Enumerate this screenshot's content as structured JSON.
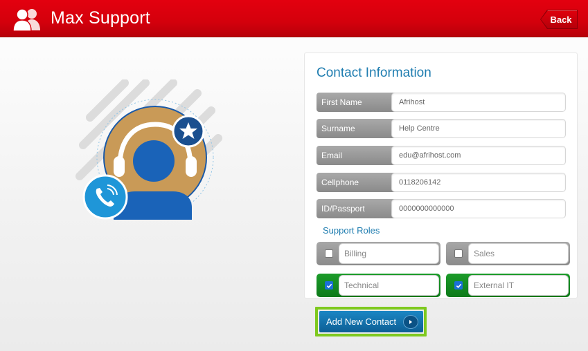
{
  "header": {
    "title": "Max Support",
    "back_label": "Back",
    "icon": "users-icon"
  },
  "colors": {
    "brand_red": "#d4000c",
    "accent_blue": "#1f7db0",
    "checked_green": "#0d7a19",
    "highlight_green": "#7ec91f"
  },
  "form": {
    "title": "Contact Information",
    "fields": [
      {
        "label": "First Name",
        "value": "Afrihost"
      },
      {
        "label": "Surname",
        "value": "Help Centre"
      },
      {
        "label": "Email",
        "value": "edu@afrihost.com"
      },
      {
        "label": "Cellphone",
        "value": "0118206142"
      },
      {
        "label": "ID/Passport",
        "value": "0000000000000"
      }
    ],
    "roles_title": "Support Roles",
    "roles": [
      {
        "label": "Billing",
        "checked": false
      },
      {
        "label": "Sales",
        "checked": false
      },
      {
        "label": "Technical",
        "checked": true
      },
      {
        "label": "External IT",
        "checked": true
      }
    ],
    "add_button_label": "Add New Contact"
  }
}
